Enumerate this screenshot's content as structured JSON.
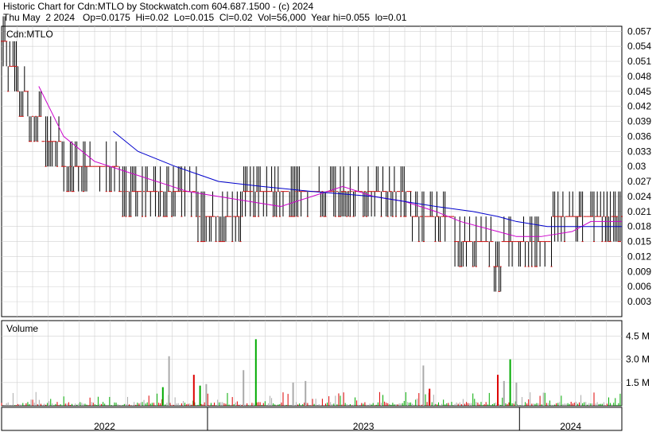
{
  "header": {
    "line1": "Historic Chart for Cdn:MTLO by Stockwatch.com 604.687.1500 - (c) 2024",
    "line2": "Thu May  2 2024   Op=0.0175  Hi=0.02  Lo=0.015  Cl=0.02  Vol=56,000  Year hi=0.055  lo=0.01"
  },
  "colors": {
    "up": "#cc0000",
    "bar": "#000000",
    "ma_short": "#cc00cc",
    "ma_long": "#0000cc",
    "vol_up": "#00aa00",
    "vol_down": "#dd0000",
    "vol_neutral": "#aaaaaa",
    "grid": "#d0d0d0"
  },
  "chart_data": [
    {
      "type": "ohlc",
      "symbol_label": "Cdn:MTLO",
      "ylim": [
        0.0,
        0.058
      ],
      "y_ticks": [
        "0.057",
        "0.054",
        "0.051",
        "0.048",
        "0.045",
        "0.042",
        "0.039",
        "0.036",
        "0.033",
        "0.03",
        "0.027",
        "0.024",
        "0.021",
        "0.018",
        "0.015",
        "0.012",
        "0.009",
        "0.006",
        "0.003"
      ],
      "y_tick_values": [
        0.057,
        0.054,
        0.051,
        0.048,
        0.045,
        0.042,
        0.039,
        0.036,
        0.033,
        0.03,
        0.027,
        0.024,
        0.021,
        0.018,
        0.015,
        0.012,
        0.009,
        0.006,
        0.003
      ],
      "x_labels": [
        "2022",
        "2023",
        "2024"
      ],
      "x_period_fractions": [
        0.0,
        0.332,
        0.835,
        1.0
      ],
      "price_path": [
        {
          "t": 0.0,
          "v": 0.055
        },
        {
          "t": 0.02,
          "v": 0.05
        },
        {
          "t": 0.05,
          "v": 0.04
        },
        {
          "t": 0.08,
          "v": 0.035
        },
        {
          "t": 0.12,
          "v": 0.03
        },
        {
          "t": 0.18,
          "v": 0.03
        },
        {
          "t": 0.2,
          "v": 0.025
        },
        {
          "t": 0.3,
          "v": 0.025
        },
        {
          "t": 0.33,
          "v": 0.02
        },
        {
          "t": 0.45,
          "v": 0.025
        },
        {
          "t": 0.55,
          "v": 0.025
        },
        {
          "t": 0.62,
          "v": 0.025
        },
        {
          "t": 0.7,
          "v": 0.02
        },
        {
          "t": 0.76,
          "v": 0.015
        },
        {
          "t": 0.8,
          "v": 0.012
        },
        {
          "t": 0.83,
          "v": 0.015
        },
        {
          "t": 0.9,
          "v": 0.018
        },
        {
          "t": 0.95,
          "v": 0.02
        },
        {
          "t": 1.0,
          "v": 0.018
        }
      ],
      "series": [
        {
          "name": "",
          "type": "line",
          "color": "#cc00cc",
          "t": [
            0.06,
            0.1,
            0.15,
            0.2,
            0.3,
            0.35,
            0.45,
            0.5,
            0.55,
            0.6,
            0.65,
            0.7,
            0.74,
            0.8,
            0.83,
            0.87,
            0.92,
            0.95,
            1.0
          ],
          "values": [
            0.046,
            0.036,
            0.031,
            0.029,
            0.025,
            0.024,
            0.022,
            0.024,
            0.026,
            0.024,
            0.023,
            0.021,
            0.019,
            0.017,
            0.016,
            0.016,
            0.017,
            0.019,
            0.019
          ]
        },
        {
          "name": "",
          "type": "line",
          "color": "#0000cc",
          "t": [
            0.18,
            0.22,
            0.28,
            0.35,
            0.42,
            0.5,
            0.6,
            0.7,
            0.76,
            0.8,
            0.83,
            0.88,
            0.95,
            1.0
          ],
          "values": [
            0.037,
            0.033,
            0.03,
            0.027,
            0.026,
            0.025,
            0.024,
            0.022,
            0.021,
            0.02,
            0.019,
            0.018,
            0.018,
            0.018
          ]
        }
      ]
    },
    {
      "type": "bar",
      "title": "Volume",
      "y_ticks": [
        "4.5 M",
        "3.0 M",
        "1.5 M"
      ],
      "y_tick_values": [
        4.5,
        3.0,
        1.5
      ],
      "ylim": [
        0,
        5.5
      ],
      "unit": "M",
      "spikes": [
        {
          "t": 0.27,
          "value": 3.2,
          "color": "neutral"
        },
        {
          "t": 0.31,
          "value": 2.0,
          "color": "down"
        },
        {
          "t": 0.33,
          "value": 1.4,
          "color": "neutral"
        },
        {
          "t": 0.39,
          "value": 2.3,
          "color": "neutral"
        },
        {
          "t": 0.41,
          "value": 4.3,
          "color": "up"
        },
        {
          "t": 0.47,
          "value": 1.5,
          "color": "neutral"
        },
        {
          "t": 0.49,
          "value": 1.6,
          "color": "neutral"
        },
        {
          "t": 0.68,
          "value": 2.6,
          "color": "neutral"
        },
        {
          "t": 0.69,
          "value": 1.1,
          "color": "down"
        },
        {
          "t": 0.8,
          "value": 2.0,
          "color": "down"
        },
        {
          "t": 0.82,
          "value": 3.0,
          "color": "up"
        },
        {
          "t": 0.81,
          "value": 1.6,
          "color": "neutral"
        },
        {
          "t": 0.83,
          "value": 1.5,
          "color": "neutral"
        },
        {
          "t": 0.26,
          "value": 1.2,
          "color": "up"
        },
        {
          "t": 0.32,
          "value": 1.3,
          "color": "up"
        }
      ]
    }
  ]
}
